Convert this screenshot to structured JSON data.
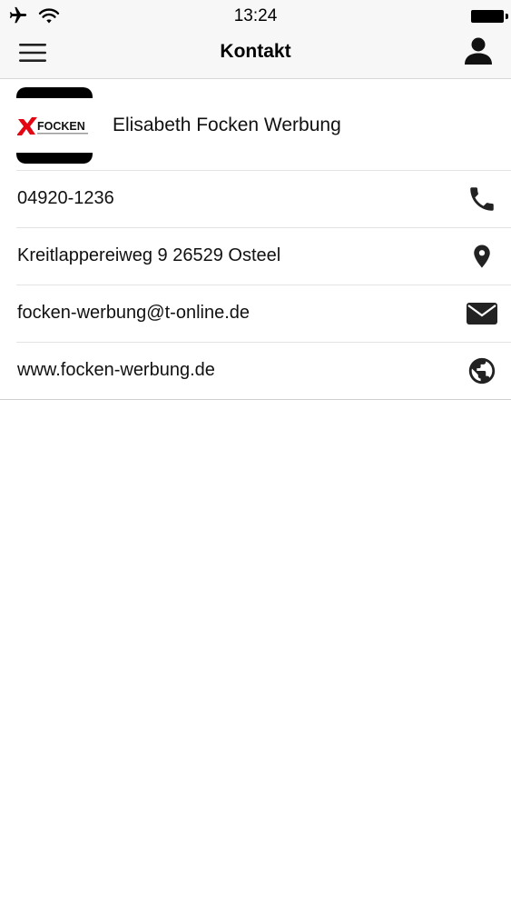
{
  "status_bar": {
    "time": "13:24",
    "icons": [
      "airplane-icon",
      "wifi-icon",
      "battery-icon"
    ]
  },
  "nav": {
    "title": "Kontakt",
    "left_icon": "hamburger-menu-icon",
    "right_icon": "user-icon"
  },
  "company": {
    "name": "Elisabeth Focken Werbung",
    "logo_text": "FOCKEN"
  },
  "contacts": [
    {
      "value": "04920-1236",
      "icon": "phone-icon"
    },
    {
      "value": "Kreitlappereiweg 9 26529 Osteel",
      "icon": "location-pin-icon"
    },
    {
      "value": "focken-werbung@t-online.de",
      "icon": "mail-icon"
    },
    {
      "value": "www.focken-werbung.de",
      "icon": "globe-icon"
    }
  ],
  "colors": {
    "bar_background": "#f7f7f7",
    "logo_red": "#e30613",
    "text": "#111111"
  }
}
